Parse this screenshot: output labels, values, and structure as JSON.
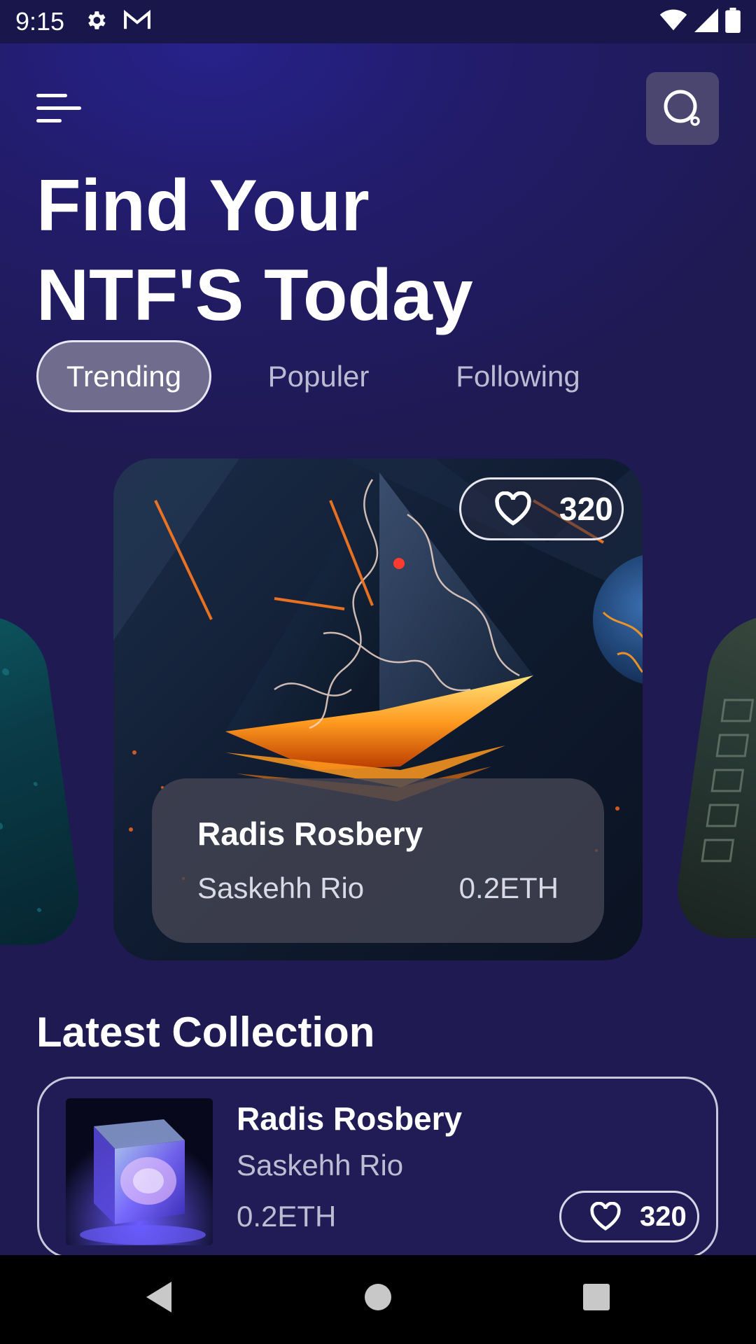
{
  "status_bar": {
    "time": "9:15",
    "left_icons": [
      "settings-icon",
      "gmail-icon"
    ],
    "right_icons": [
      "wifi-icon",
      "signal-icon",
      "battery-icon"
    ]
  },
  "header": {
    "menu_icon": "menu-icon",
    "search_icon": "search-icon",
    "headline_line1": "Find Your",
    "headline_line2": "NTF'S Today"
  },
  "tabs": [
    {
      "label": "Trending",
      "active": true
    },
    {
      "label": "Populer",
      "active": false
    },
    {
      "label": "Following",
      "active": false
    }
  ],
  "featured": {
    "likes": "320",
    "title": "Radis Rosbery",
    "artist": "Saskehh Rio",
    "price": "0.2ETH"
  },
  "latest_collection": {
    "section_title": "Latest Collection",
    "items": [
      {
        "title": "Radis Rosbery",
        "artist": "Saskehh Rio",
        "price": "0.2ETH",
        "likes": "320"
      }
    ]
  },
  "nav_bar": {
    "back_icon": "back-icon",
    "home_icon": "home-icon",
    "recents_icon": "recents-icon"
  },
  "colors": {
    "background": "#1f1a52",
    "status_bar": "#18164a",
    "tab_active_bg": "#6f6c8e",
    "panel": "#464654",
    "accent_orange": "#ff8a1e"
  }
}
